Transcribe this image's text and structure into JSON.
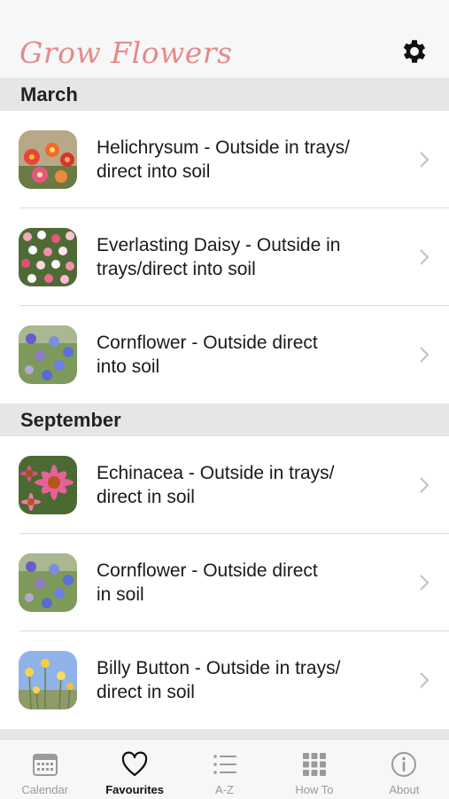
{
  "header": {
    "title": "Grow Flowers",
    "settings_icon": "gear-icon"
  },
  "sections": [
    {
      "title": "March",
      "items": [
        {
          "label": "Helichrysum - Outside in trays/\ndirect into soil",
          "thumb": "helichrysum"
        },
        {
          "label": "Everlasting Daisy - Outside in\ntrays/direct into soil",
          "thumb": "everlasting-daisy"
        },
        {
          "label": "Cornflower - Outside direct\ninto soil",
          "thumb": "cornflower"
        }
      ]
    },
    {
      "title": "September",
      "items": [
        {
          "label": "Echinacea - Outside in trays/\ndirect in soil",
          "thumb": "echinacea"
        },
        {
          "label": "Cornflower -  Outside direct\nin soil",
          "thumb": "cornflower"
        },
        {
          "label": "Billy Button -  Outside in trays/\ndirect in soil",
          "thumb": "billy-button"
        }
      ]
    }
  ],
  "tabs": [
    {
      "label": "Calendar",
      "icon": "calendar-icon",
      "active": false
    },
    {
      "label": "Favourites",
      "icon": "heart-icon",
      "active": true
    },
    {
      "label": "A-Z",
      "icon": "list-icon",
      "active": false
    },
    {
      "label": "How To",
      "icon": "grid-icon",
      "active": false
    },
    {
      "label": "About",
      "icon": "info-icon",
      "active": false
    }
  ],
  "colors": {
    "title": "#e48b8b",
    "section_bg": "#e6e6e6",
    "tab_inactive": "#9a9a9a"
  }
}
